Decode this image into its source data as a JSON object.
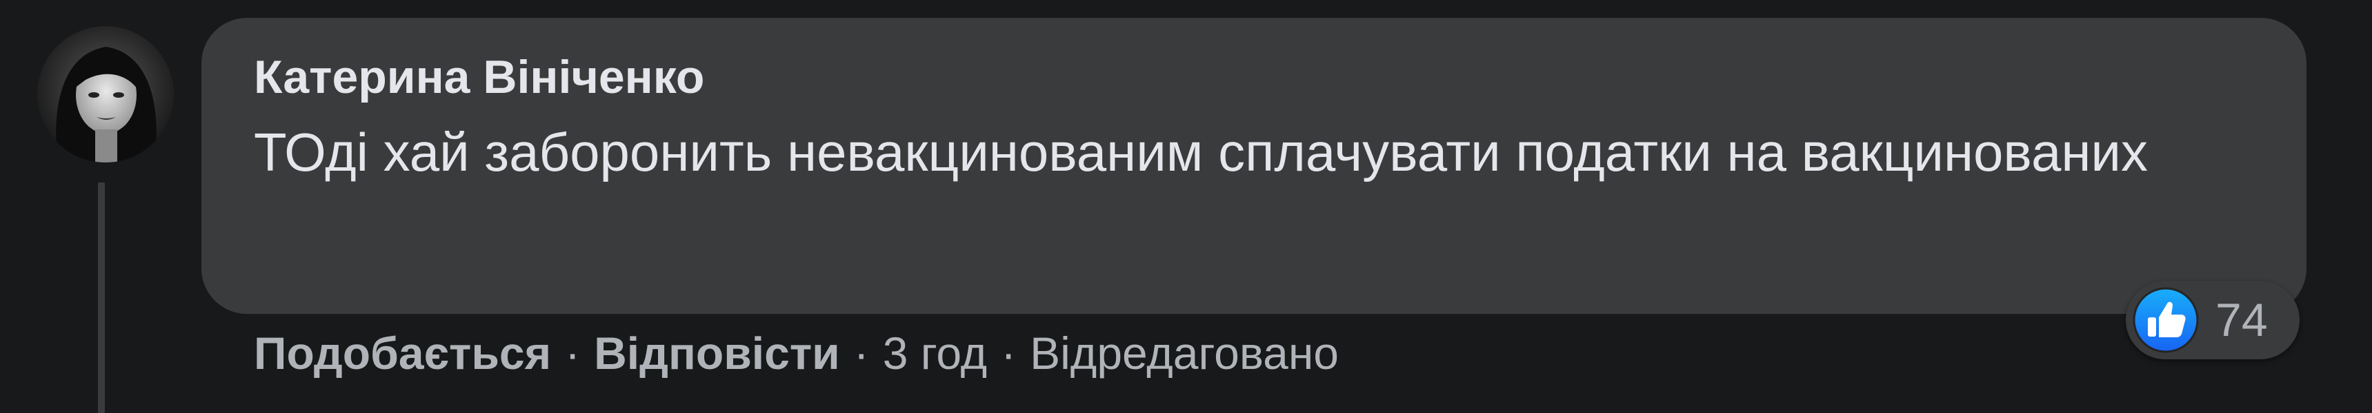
{
  "comment": {
    "author": "Катерина Вініченко",
    "text": "ТОді хай заборонить невакцинованим сплачувати податки на вакцинованих",
    "reactions": {
      "icon": "like-icon",
      "color": "#1877f2",
      "count": "74"
    },
    "actions": {
      "like": "Подобається",
      "reply": "Відповісти",
      "time": "3 год",
      "edited": "Відредаговано",
      "separator": "·"
    }
  },
  "colors": {
    "background": "#18191a",
    "bubble": "#3a3b3c",
    "text_primary": "#e4e6eb",
    "text_secondary": "#b0b3b8",
    "like_blue": "#1877f2"
  }
}
